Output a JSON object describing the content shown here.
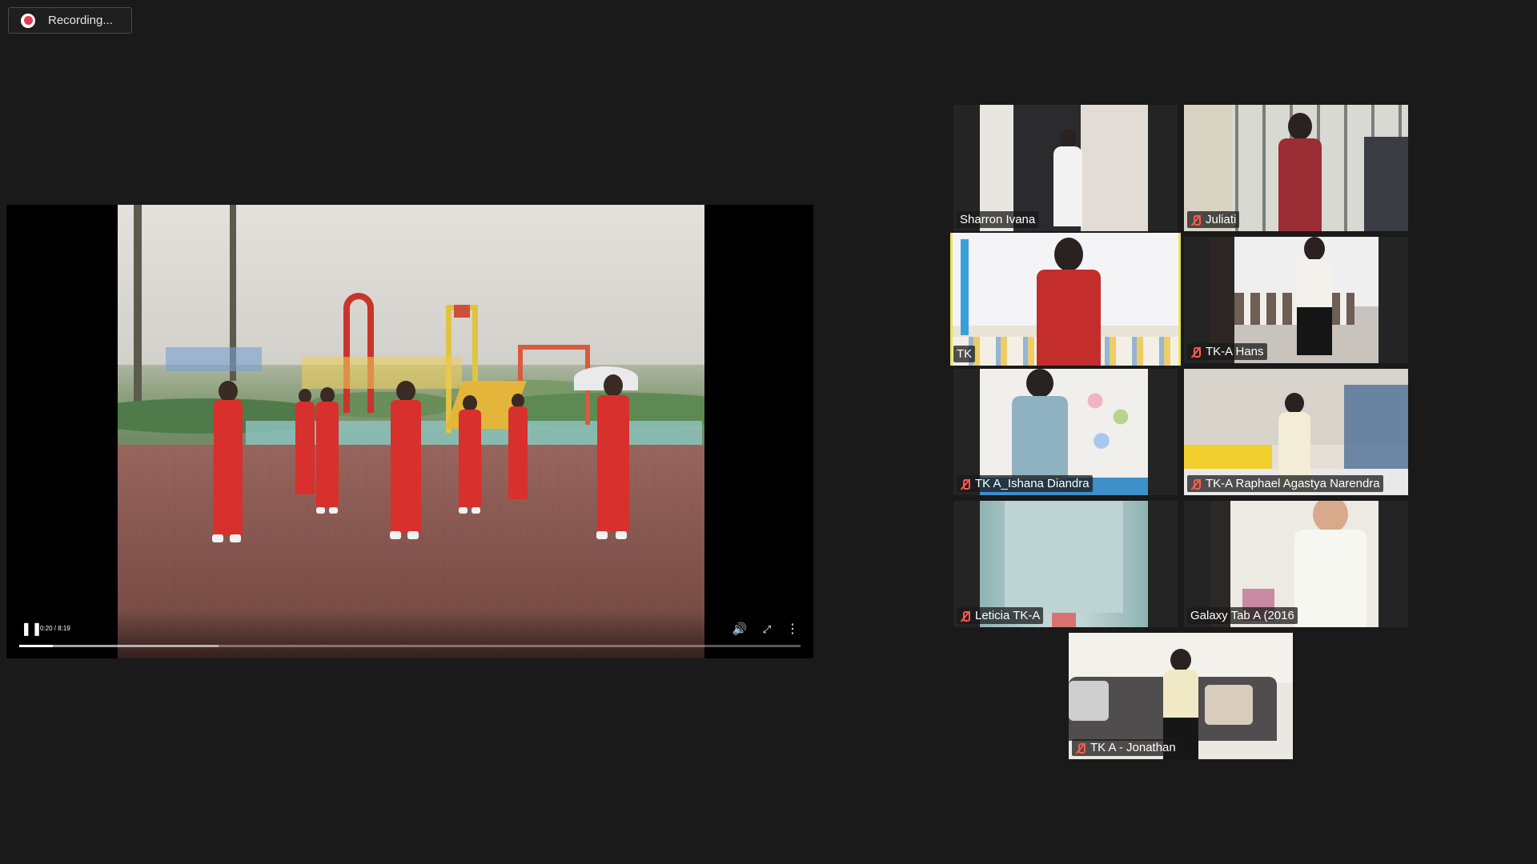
{
  "recording": {
    "label": "Recording..."
  },
  "player": {
    "time": "0:20 / 8:19",
    "played_fraction": 0.043,
    "buffered_fraction": 0.255
  },
  "participants": [
    {
      "name": "Sharron Ivana",
      "muted": false
    },
    {
      "name": "Juliati",
      "muted": true
    },
    {
      "name": "TK",
      "muted": false,
      "active_speaker": true
    },
    {
      "name": "TK-A Hans",
      "muted": true
    },
    {
      "name": "TK A_Ishana Diandra",
      "muted": true
    },
    {
      "name": "TK-A Raphael Agastya Narendra",
      "muted": true
    },
    {
      "name": "Leticia TK-A",
      "muted": true
    },
    {
      "name": "Galaxy Tab A (2016",
      "muted": false
    },
    {
      "name": "TK A - Jonathan",
      "muted": true
    }
  ],
  "colors": {
    "active_border": "#e9e45a",
    "mute_icon": "#ff5a4f",
    "recording_dot": "#e8394f"
  }
}
